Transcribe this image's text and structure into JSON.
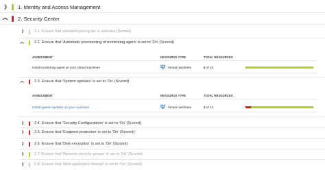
{
  "colors": {
    "pass": "#b4cc1d",
    "fail": "#d71e25",
    "na": "#cccccc",
    "link": "#1a6ec8"
  },
  "sections": [
    {
      "label": "1. Identity and Access Management",
      "status": "pass",
      "chevron": "chevron-right-icon"
    },
    {
      "label": "2. Security Center",
      "status": "fail",
      "chevron": "chevron-down-icon"
    }
  ],
  "controls": [
    {
      "label": "2.1. Ensure that standard pricing tier is selected (Scored)",
      "status": "na",
      "dim": true
    },
    {
      "label": "2.2. Ensure that 'Automatic provisioning of monitoring agent' is set to 'On' (Scored)",
      "status": "pass",
      "dim": false
    },
    {
      "label": "2.3. Ensure that 'System updates' is set to 'On' (Scored)",
      "status": "fail",
      "dim": false
    },
    {
      "label": "2.4. Ensure that 'Security Configurations' is set to 'On' (Scored)",
      "status": "fail",
      "dim": false
    },
    {
      "label": "2.5. Ensure that 'Endpoint protection' is set to 'On' (Scored)",
      "status": "fail",
      "dim": false
    },
    {
      "label": "2.6. Ensure that 'Disk encryption' is set to 'On' (Scored)",
      "status": "fail",
      "dim": false
    },
    {
      "label": "2.7. Ensure that 'Network security groups' is set to 'On' (Scored)",
      "status": "pass",
      "dim": true
    },
    {
      "label": "2.8. Ensure that 'Web application firewall' is set to 'On' (Scored)",
      "status": "na",
      "dim": true
    }
  ],
  "table_headers": {
    "assessment": "ASSESSMENT",
    "resource_type": "RESOURCE TYPE",
    "total_resources": "TOTAL RESOURCES"
  },
  "assessments": [
    {
      "name": "Install monitoring agent on your virtual machines",
      "link": false,
      "resource_type": "Virtual machines",
      "count": "0",
      "total": "of 13",
      "fail_fraction": 0.0
    },
    {
      "name": "Install system updates on your machines",
      "link": true,
      "resource_type": "Virtual machines",
      "count": "1",
      "total": "of 13",
      "fail_fraction": 0.077
    }
  ]
}
